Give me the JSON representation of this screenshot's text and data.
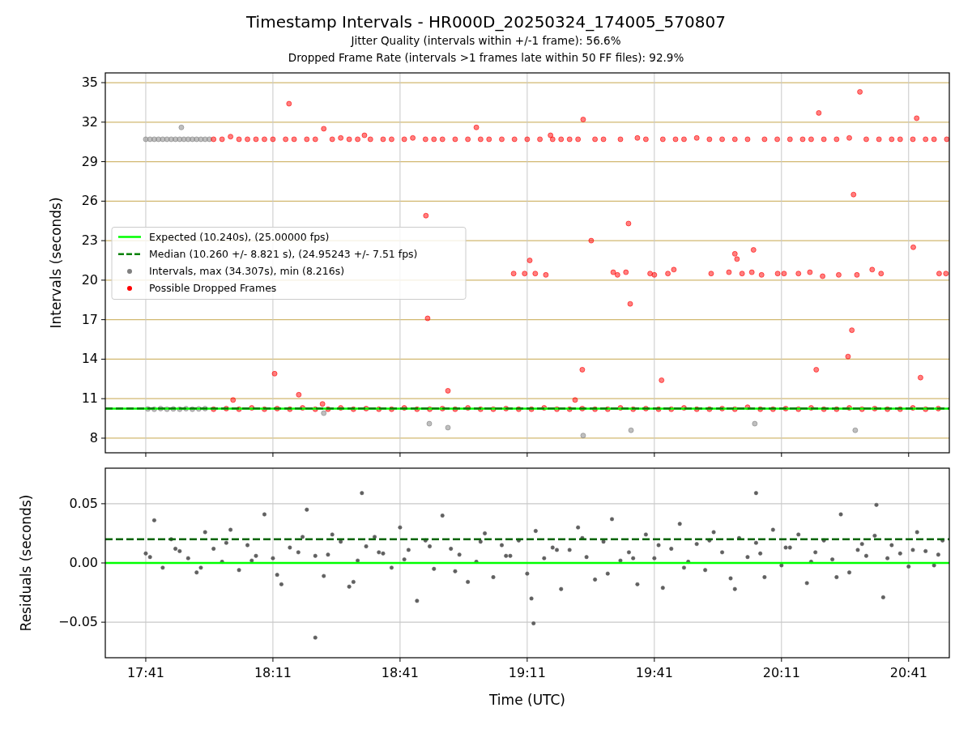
{
  "figure": {
    "title": "Timestamp Intervals - HR000D_20250324_174005_570807",
    "subtitles": [
      "Jitter Quality (intervals within +/-1 frame): 56.6%",
      "Dropped Frame Rate (intervals >1 frames late within 50 FF files): 92.9%"
    ]
  },
  "charts": [
    {
      "chart_data": {
        "type": "scatter",
        "ylabel": "Intervals (seconds)",
        "xlim": [
          1051.45,
          1250.6
        ],
        "ylim": [
          6.89,
          35.74
        ],
        "yticks": [
          {
            "value": 8,
            "label": "8"
          },
          {
            "value": 11,
            "label": "11"
          },
          {
            "value": 14,
            "label": "14"
          },
          {
            "value": 17,
            "label": "17"
          },
          {
            "value": 20,
            "label": "20"
          },
          {
            "value": 23,
            "label": "23"
          },
          {
            "value": 26,
            "label": "26"
          },
          {
            "value": 29,
            "label": "29"
          },
          {
            "value": 32,
            "label": "32"
          },
          {
            "value": 35,
            "label": "35"
          }
        ],
        "grid": true,
        "legend": "center left",
        "ref_lines": [
          {
            "axis": "y",
            "value": 10.24,
            "label": "Expected (10.240s), (25.00000 fps)",
            "color": "#00ff00"
          },
          {
            "axis": "y",
            "value": 10.26,
            "label": "Median (10.260 +/- 8.821 s), (24.95243 +/- 7.51 fps)",
            "color": "#008000"
          }
        ],
        "series": [
          {
            "name": "Intervals, max (34.307s), min (8.216s)",
            "color": "#808080",
            "x": [
              1061,
              1062,
              1063,
              1064,
              1065,
              1066,
              1067,
              1068,
              1069,
              1069.4,
              1070,
              1071,
              1072,
              1073,
              1074,
              1075,
              1076,
              1061.5,
              1063,
              1064.5,
              1066,
              1067.5,
              1069,
              1070.5,
              1072,
              1073.5,
              1075,
              1076.5,
              1103,
              1127.9,
              1132.3,
              1164.2,
              1175.5,
              1204.7,
              1228.4
            ],
            "values": [
              30.7,
              30.7,
              30.7,
              30.7,
              30.7,
              30.7,
              30.7,
              30.7,
              30.7,
              31.6,
              30.7,
              30.7,
              30.7,
              30.7,
              30.7,
              30.7,
              30.7,
              10.22,
              10.2,
              10.25,
              10.2,
              10.22,
              10.2,
              10.24,
              10.2,
              10.22,
              10.25,
              null,
              9.9,
              9.1,
              8.8,
              8.2,
              8.6,
              9.1,
              8.6
            ]
          },
          {
            "name": "Possible Dropped Frames",
            "color": "#ff0000",
            "x": [
              1077,
              1079,
              1081,
              1083,
              1085,
              1087,
              1089,
              1091,
              1094,
              1096,
              1099,
              1101,
              1105,
              1107,
              1109,
              1111,
              1114,
              1117,
              1119,
              1122,
              1124,
              1127,
              1129,
              1131,
              1134,
              1137,
              1140,
              1142,
              1145,
              1148,
              1151,
              1154,
              1157,
              1159,
              1161,
              1163,
              1167,
              1169,
              1173,
              1177,
              1179,
              1183,
              1186,
              1188,
              1191,
              1194,
              1197,
              1200,
              1203,
              1207,
              1210,
              1213,
              1216,
              1218,
              1221,
              1224,
              1227,
              1231,
              1234,
              1237,
              1239,
              1242,
              1245,
              1247,
              1250,
              1094.8,
              1103,
              1139,
              1164.2,
              1219.8,
              1229.5,
              1242.9,
              1112.6,
              1156.5,
              1127.1,
              1127.5,
              1132.3,
              1147.8,
              1150.4,
              1151.6,
              1152.9,
              1155.4,
              1164,
              1162.3,
              1166.1,
              1171.3,
              1172.3,
              1174.3,
              1174.9,
              1175.3,
              1180,
              1181,
              1182.7,
              1184.2,
              1185.6,
              1194.4,
              1198.6,
              1200,
              1200.5,
              1201.7,
              1204,
              1204.4,
              1206.3,
              1210.1,
              1211.6,
              1215,
              1217.7,
              1219.2,
              1220.7,
              1224.5,
              1226.7,
              1227.6,
              1228,
              1228.8,
              1232.4,
              1234.5,
              1242.1,
              1243.8,
              1248.2,
              1249.8,
              1081.6,
              1091.4,
              1097.1,
              1102.7,
              1077,
              1080,
              1083,
              1086,
              1089,
              1092,
              1095,
              1098,
              1101,
              1104,
              1107,
              1110,
              1113,
              1116,
              1119,
              1122,
              1125,
              1128,
              1131,
              1134,
              1137,
              1140,
              1143,
              1146,
              1149,
              1152,
              1155,
              1158,
              1161,
              1164,
              1167,
              1170,
              1173,
              1176,
              1179,
              1182,
              1185,
              1188,
              1191,
              1194,
              1197,
              1200,
              1203,
              1206,
              1209,
              1212,
              1215,
              1218,
              1221,
              1224,
              1227,
              1230,
              1233,
              1236,
              1239,
              1242,
              1245,
              1248
            ],
            "values": [
              30.7,
              30.7,
              30.9,
              30.7,
              30.7,
              30.7,
              30.7,
              30.7,
              30.7,
              30.7,
              30.7,
              30.7,
              30.7,
              30.8,
              30.7,
              30.7,
              30.7,
              30.7,
              30.7,
              30.7,
              30.8,
              30.7,
              30.7,
              30.7,
              30.7,
              30.7,
              30.7,
              30.7,
              30.7,
              30.7,
              30.7,
              30.7,
              30.7,
              30.7,
              30.7,
              30.7,
              30.7,
              30.7,
              30.7,
              30.8,
              30.7,
              30.7,
              30.7,
              30.7,
              30.8,
              30.7,
              30.7,
              30.7,
              30.7,
              30.7,
              30.7,
              30.7,
              30.7,
              30.7,
              30.7,
              30.7,
              30.8,
              30.7,
              30.7,
              30.7,
              30.7,
              30.7,
              30.7,
              30.7,
              30.7,
              33.4,
              31.5,
              31.6,
              32.2,
              32.7,
              34.3,
              32.3,
              31.0,
              31.0,
              24.9,
              17.1,
              11.6,
              20.5,
              20.5,
              21.5,
              20.5,
              20.4,
              13.2,
              10.9,
              23.0,
              20.6,
              20.4,
              20.6,
              24.3,
              18.2,
              20.5,
              20.4,
              12.4,
              20.5,
              20.8,
              20.5,
              20.6,
              22.0,
              21.6,
              20.5,
              20.6,
              22.3,
              20.4,
              20.5,
              20.5,
              20.5,
              20.6,
              13.2,
              20.3,
              20.4,
              14.2,
              16.2,
              26.5,
              20.4,
              20.8,
              20.5,
              22.5,
              12.6,
              20.5,
              20.5,
              10.9,
              12.9,
              11.3,
              10.6,
              10.2,
              10.25,
              10.2,
              10.3,
              10.2,
              10.25,
              10.2,
              10.3,
              10.2,
              10.2,
              10.3,
              10.2,
              10.25,
              10.2,
              10.2,
              10.3,
              10.2,
              10.2,
              10.25,
              10.2,
              10.3,
              10.2,
              10.2,
              10.25,
              10.2,
              10.2,
              10.3,
              10.2,
              10.2,
              10.25,
              10.2,
              10.2,
              10.3,
              10.2,
              10.25,
              10.2,
              10.2,
              10.3,
              10.2,
              10.2,
              10.25,
              10.2,
              10.35,
              10.2,
              10.2,
              10.25,
              10.2,
              10.3,
              10.2,
              10.2,
              10.3,
              10.2,
              10.25,
              10.2,
              10.2,
              10.3,
              10.2,
              10.25
            ]
          }
        ]
      }
    },
    {
      "chart_data": {
        "type": "scatter",
        "xlabel": "Time (UTC)",
        "ylabel": "Residuals (seconds)",
        "xlim": [
          1051.45,
          1250.6
        ],
        "ylim": [
          -0.08,
          0.08
        ],
        "xticks": [
          {
            "value": 1061,
            "label": "17:41"
          },
          {
            "value": 1091,
            "label": "18:11"
          },
          {
            "value": 1121,
            "label": "18:41"
          },
          {
            "value": 1151,
            "label": "19:11"
          },
          {
            "value": 1181,
            "label": "19:41"
          },
          {
            "value": 1211,
            "label": "20:11"
          },
          {
            "value": 1241,
            "label": "20:41"
          }
        ],
        "yticks": [
          {
            "value": 0.05,
            "label": "0.05"
          },
          {
            "value": 0,
            "label": "0.00"
          },
          {
            "value": -0.05,
            "label": "−0.05"
          }
        ],
        "grid": true,
        "ref_lines": [
          {
            "axis": "y",
            "value": 0,
            "color": "#00ff00"
          },
          {
            "axis": "y",
            "value": 0.02,
            "color": "#006400"
          }
        ],
        "series": [
          {
            "color": "#606060",
            "x": [
              1061,
              1063,
              1065,
              1067,
              1069,
              1071,
              1073,
              1075,
              1077,
              1079,
              1081,
              1083,
              1085,
              1087,
              1089,
              1091,
              1093,
              1095,
              1097,
              1099,
              1101,
              1103,
              1105,
              1107,
              1109,
              1111,
              1113,
              1115,
              1117,
              1119,
              1121,
              1123,
              1125,
              1127,
              1129,
              1131,
              1133,
              1135,
              1137,
              1139,
              1141,
              1143,
              1145,
              1147,
              1149,
              1151,
              1153,
              1155,
              1157,
              1159,
              1161,
              1163,
              1165,
              1167,
              1169,
              1171,
              1173,
              1175,
              1177,
              1179,
              1181,
              1183,
              1185,
              1187,
              1189,
              1191,
              1193,
              1195,
              1197,
              1199,
              1201,
              1203,
              1205,
              1207,
              1209,
              1211,
              1213,
              1215,
              1217,
              1219,
              1221,
              1223,
              1225,
              1227,
              1229,
              1231,
              1233,
              1235,
              1237,
              1239,
              1241,
              1243,
              1245,
              1247,
              1249,
              1112,
              1101,
              1152.5,
              1205,
              1233.4,
              1062,
              1068,
              1074,
              1080,
              1086,
              1092,
              1098,
              1104,
              1110,
              1116,
              1122,
              1128,
              1134,
              1140,
              1146,
              1152,
              1158,
              1164,
              1170,
              1176,
              1182,
              1188,
              1194,
              1200,
              1206,
              1212,
              1218,
              1224,
              1230,
              1236,
              1242,
              1248
            ],
            "values": [
              0.008,
              0.036,
              -0.004,
              0.02,
              0.01,
              0.004,
              -0.008,
              0.026,
              0.012,
              0.001,
              0.028,
              -0.006,
              0.015,
              0.006,
              0.041,
              0.004,
              -0.018,
              0.013,
              0.009,
              0.045,
              0.006,
              -0.011,
              0.024,
              0.018,
              -0.02,
              0.002,
              0.014,
              0.022,
              0.008,
              -0.004,
              0.03,
              0.011,
              -0.032,
              0.019,
              -0.005,
              0.04,
              0.012,
              0.007,
              -0.016,
              0.001,
              0.025,
              -0.012,
              0.015,
              0.006,
              0.019,
              -0.009,
              0.027,
              0.004,
              0.013,
              -0.022,
              0.011,
              0.03,
              0.005,
              -0.014,
              0.018,
              0.037,
              0.002,
              0.009,
              -0.018,
              0.024,
              0.004,
              -0.021,
              0.012,
              0.033,
              0.001,
              0.016,
              -0.006,
              0.026,
              0.009,
              -0.013,
              0.021,
              0.005,
              0.017,
              -0.012,
              0.028,
              -0.002,
              0.013,
              0.024,
              -0.017,
              0.009,
              0.019,
              0.003,
              0.041,
              -0.008,
              0.011,
              0.006,
              0.023,
              -0.029,
              0.015,
              0.008,
              -0.003,
              0.026,
              0.01,
              -0.002,
              0.019,
              0.059,
              -0.063,
              -0.051,
              0.059,
              0.049,
              0.005,
              0.012,
              -0.004,
              0.017,
              0.002,
              -0.01,
              0.022,
              0.007,
              -0.016,
              0.009,
              0.003,
              0.014,
              -0.007,
              0.018,
              0.006,
              -0.03,
              0.011,
              0.021,
              -0.009,
              0.004,
              0.015,
              -0.004,
              0.019,
              -0.022,
              0.008,
              0.013,
              0.001,
              -0.012,
              0.016,
              0.004,
              0.011,
              0.007
            ]
          }
        ]
      }
    }
  ]
}
